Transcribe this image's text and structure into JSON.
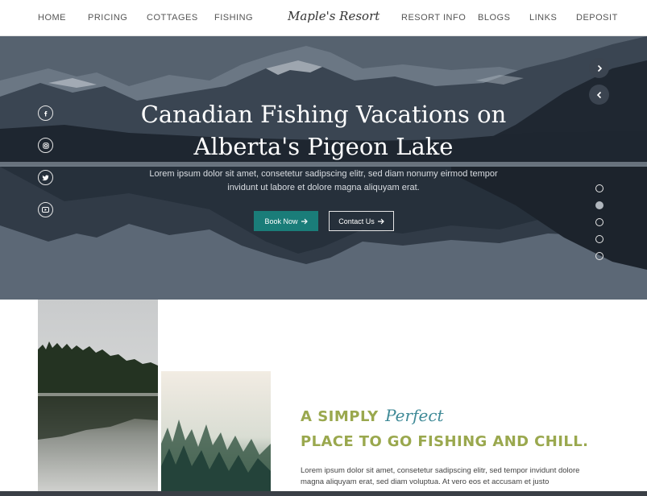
{
  "nav": {
    "left": [
      "HOME",
      "PRICING",
      "COTTAGES",
      "FISHING"
    ],
    "logo": "Maple's Resort",
    "right": [
      "RESORT INFO",
      "BLOGS",
      "LINKS",
      "DEPOSIT"
    ]
  },
  "hero": {
    "title_line1": "Canadian Fishing Vacations on",
    "title_line2": "Alberta's Pigeon Lake",
    "subtitle": "Lorem ipsum dolor sit amet, consetetur sadipscing elitr, sed diam nonumy eirmod tempor invidunt ut labore et dolore magna aliquyam erat.",
    "book_label": "Book Now",
    "contact_label": "Contact Us",
    "social_icons": [
      "facebook-icon",
      "instagram-icon",
      "twitter-icon",
      "youtube-icon"
    ],
    "slider": {
      "total": 5,
      "active_index": 1
    }
  },
  "about": {
    "heading_a": "A SIMPLY",
    "heading_b": "Perfect",
    "heading_line2": "PLACE TO GO FISHING AND CHILL.",
    "paragraph": "Lorem ipsum dolor sit amet, consetetur sadipscing elitr, sed  tempor invidunt dolore magna aliquyam erat, sed diam voluptua. At vero eos et accusam et justo"
  },
  "colors": {
    "accent_teal": "#1a7d79",
    "heading_olive": "#9aa84e",
    "script_teal": "#3f8a97"
  }
}
